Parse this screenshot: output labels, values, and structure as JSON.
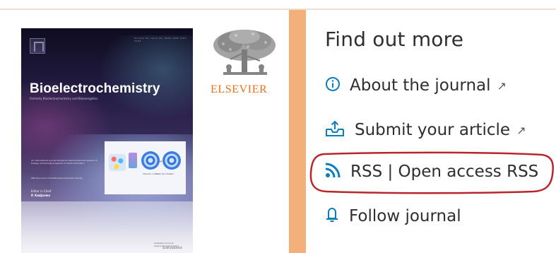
{
  "cover": {
    "journal_title": "Bioelectrochemistry",
    "subtitle": "Formerly Bioelectrochemistry and Bioenergetics",
    "top_small_text": "Volume 00, Issue 00, 0000 ISSN 1567-5394",
    "description": "An international journal devoted to electrochemical aspects of biology and biological aspects of electrochemistry",
    "description2": "Official journal of the Bioelectrochemical Society",
    "editor_label": "Editor in Chief",
    "editor_name": "P. Kadjaniez",
    "figure_captions": [
      "Skeletal muscle",
      "Electroporation",
      "Cell"
    ],
    "footer_small": "Available online at www.sciencedirect.com",
    "footer_brand": "ScienceDirect"
  },
  "publisher": {
    "wordmark": "ELSEVIER",
    "brand_color": "#e9711c"
  },
  "sidebar": {
    "heading": "Find out more",
    "links": [
      {
        "label": "About the journal",
        "icon": "info-circle-icon",
        "external": "↗"
      },
      {
        "label": "Submit your article",
        "icon": "upload-tray-icon",
        "external": "↗"
      },
      {
        "label": "RSS | Open access RSS",
        "icon": "rss-icon",
        "external": ""
      },
      {
        "label": "Follow journal",
        "icon": "bell-icon",
        "external": ""
      }
    ],
    "accent_color": "#0c7dbb"
  },
  "annotation": {
    "highlight_color": "#b8262b"
  }
}
